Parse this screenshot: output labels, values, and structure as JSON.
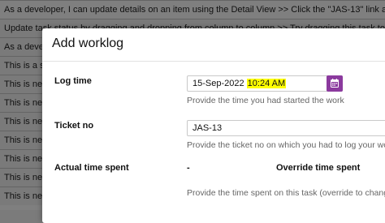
{
  "background_list": {
    "rows": [
      "As a developer, I can update details on an item using the Detail View >> Click the \"JAS-13\" link at",
      "Update task status by dragging and dropping from column to column >> Try dragging this task to",
      "As a devel",
      "This is a s",
      "This is nev",
      "This is nev",
      "This is nev",
      "This is nev",
      "This is nev",
      "This is nev",
      "This is nev"
    ]
  },
  "modal": {
    "title": "Add worklog",
    "log_time": {
      "label": "Log time",
      "date_value": "15-Sep-2022",
      "time_value": "10:24 AM",
      "help": "Provide the time you had started the work",
      "calendar_icon": "calendar-icon",
      "calendar_color": "#8b3a9e"
    },
    "ticket": {
      "label": "Ticket no",
      "value": "JAS-13",
      "help": "Provide the ticket no on which you had to log your wo"
    },
    "actual_time": {
      "label": "Actual time spent",
      "value": "-",
      "override_label": "Override time spent",
      "help": "Provide the time spent on this task (override to chang"
    }
  },
  "colors": {
    "highlight": "#ffff00",
    "accent_bar": "#0a6ea8"
  }
}
